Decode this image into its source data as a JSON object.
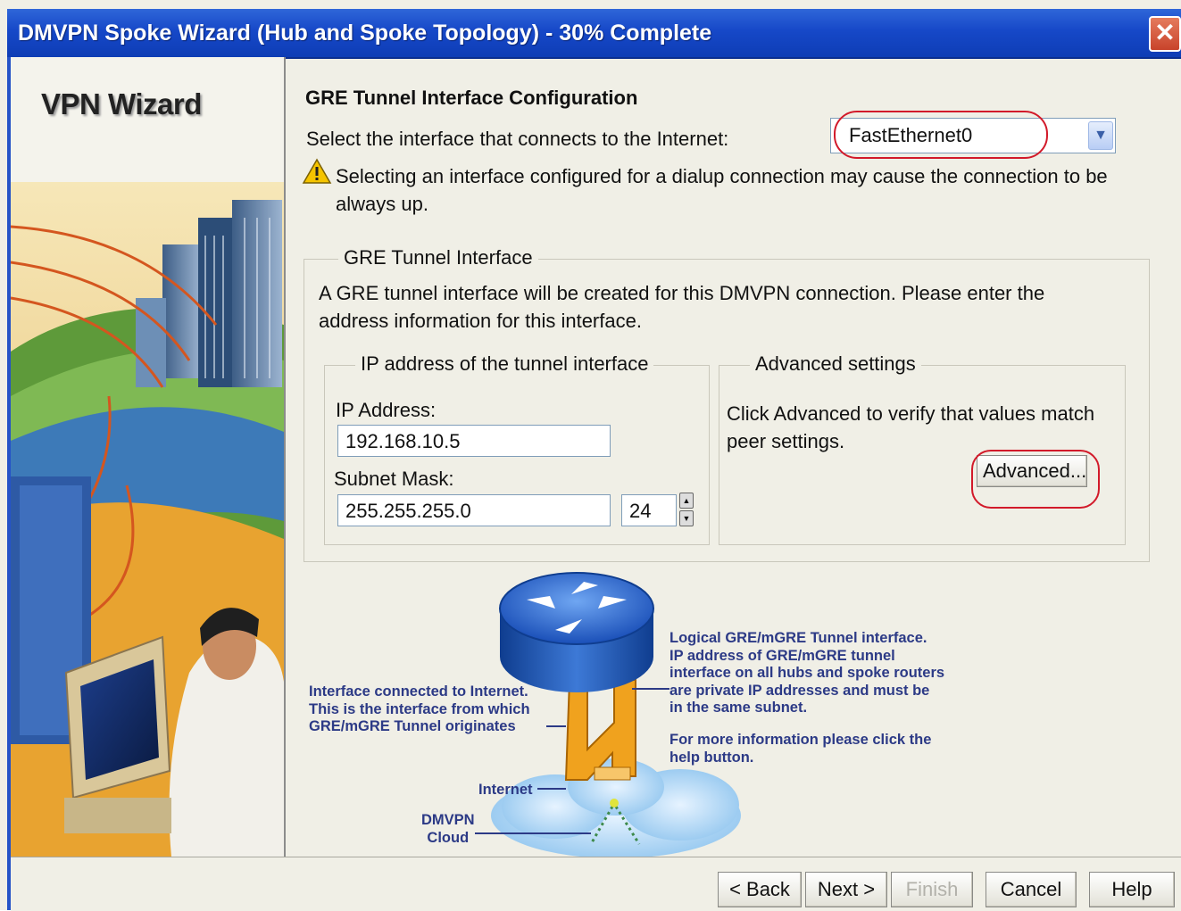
{
  "window": {
    "title": "DMVPN Spoke Wizard (Hub and Spoke Topology) - 30% Complete",
    "close_glyph": "✕"
  },
  "sidebar": {
    "heading": "VPN Wizard"
  },
  "main": {
    "section_title": "GRE Tunnel Interface Configuration",
    "interface_prompt": "Select the interface that connects to the Internet:",
    "interface_value": "FastEthernet0",
    "warning": "Selecting an interface configured for a dialup connection may cause the connection to be always up."
  },
  "gre_group": {
    "legend": "GRE Tunnel Interface",
    "description": "A GRE tunnel interface will be created for this DMVPN connection. Please enter the address information for this interface.",
    "ip_group": {
      "legend": "IP address of the tunnel interface",
      "ip_label": "IP Address:",
      "ip_value": "192.168.10.5",
      "mask_label": "Subnet Mask:",
      "mask_value": "255.255.255.0",
      "prefix_value": "24"
    },
    "advanced_group": {
      "legend": "Advanced settings",
      "text": "Click Advanced to verify that values match peer settings.",
      "button": "Advanced..."
    }
  },
  "diagram": {
    "left_callout": [
      "Interface connected to Internet.",
      "This is the interface from which",
      "GRE/mGRE Tunnel originates"
    ],
    "right_callout": [
      "Logical GRE/mGRE Tunnel interface.",
      "IP address of GRE/mGRE tunnel",
      "interface on all hubs and spoke routers",
      "are private IP addresses and must be",
      "in the same subnet."
    ],
    "help_callout": [
      "For more information please click the",
      "help button."
    ],
    "internet_label": "Internet",
    "cloud_label": [
      "DMVPN",
      "Cloud"
    ]
  },
  "buttons": {
    "back": "< Back",
    "next": "Next >",
    "finish": "Finish",
    "cancel": "Cancel",
    "help": "Help"
  },
  "colors": {
    "titlebar": "#1648c8",
    "highlight": "#d21a2a",
    "callout_text": "#2c3a86",
    "panel_bg": "#f0efe6"
  },
  "icons": {
    "warning": "warning-triangle-icon",
    "dropdown": "chevron-down-icon",
    "spinner": "spinner-updown-icon"
  }
}
